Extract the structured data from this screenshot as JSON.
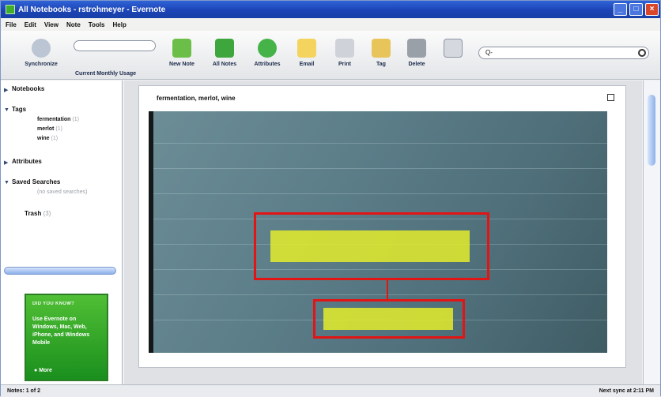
{
  "window": {
    "title": "All Notebooks - rstrohmeyer - Evernote"
  },
  "menu": [
    "File",
    "Edit",
    "View",
    "Note",
    "Tools",
    "Help"
  ],
  "toolbar": {
    "sync": "Synchronize",
    "usage": "Current Monthly Usage",
    "new_note": "New Note",
    "all_notes": "All Notes",
    "attributes": "Attributes",
    "email": "Email",
    "print": "Print",
    "tag": "Tag",
    "delete": "Delete",
    "search_placeholder": "Q-"
  },
  "sidebar": {
    "notebooks": "Notebooks",
    "tags": "Tags",
    "tag_items": [
      {
        "name": "fermentation",
        "count": "(1)"
      },
      {
        "name": "merlot",
        "count": "(1)"
      },
      {
        "name": "wine",
        "count": "(1)"
      }
    ],
    "attributes": "Attributes",
    "saved": "Saved Searches",
    "saved_hint": "(no saved searches)",
    "trash": "Trash",
    "trash_count": "(3)"
  },
  "ad": {
    "heading": "DID YOU KNOW?",
    "text": "Use Evernote on Windows, Mac, Web, iPhone, and Windows Mobile",
    "more": "More"
  },
  "note": {
    "tags": "fermentation, merlot, wine"
  },
  "status": {
    "left": "Notes: 1 of 2",
    "right": "Next sync at 2:11 PM"
  }
}
